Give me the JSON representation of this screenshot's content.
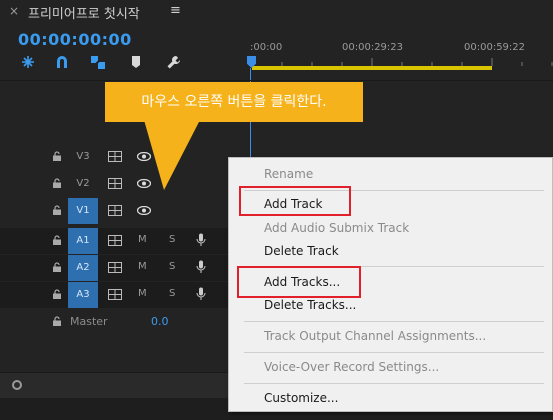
{
  "tab": {
    "close_label": "×",
    "title": "프리미어프로 첫시작",
    "menu_label": "≡"
  },
  "timecode": "00:00:00:00",
  "tools": [
    "ripple-snap-icon",
    "magnet-icon",
    "linked-selection-icon",
    "marker-icon",
    "wrench-icon"
  ],
  "ruler": {
    "labels": [
      ":00:00",
      "00:00:29:23",
      "00:00:59:22"
    ]
  },
  "tracks": [
    {
      "name": "V3",
      "kind": "video",
      "active": false
    },
    {
      "name": "V2",
      "kind": "video",
      "active": false
    },
    {
      "name": "V1",
      "kind": "video",
      "active": true
    },
    {
      "name": "A1",
      "kind": "audio",
      "active": true,
      "m": "M",
      "s": "S"
    },
    {
      "name": "A2",
      "kind": "audio",
      "active": true,
      "m": "M",
      "s": "S"
    },
    {
      "name": "A3",
      "kind": "audio",
      "active": true,
      "m": "M",
      "s": "S"
    }
  ],
  "master": {
    "label": "Master",
    "value": "0.0"
  },
  "callout": {
    "text": "마우스 오른쪽 버튼을 클릭한다."
  },
  "menu": {
    "items": [
      {
        "label": "Rename",
        "disabled": true
      },
      {
        "label": "Add Track",
        "disabled": false,
        "highlighted": true
      },
      {
        "label": "Add Audio Submix Track",
        "disabled": true
      },
      {
        "label": "Delete Track",
        "disabled": false
      },
      {
        "label": "Add Tracks...",
        "disabled": false,
        "highlighted": true
      },
      {
        "label": "Delete Tracks...",
        "disabled": false
      },
      {
        "label": "Track Output Channel Assignments...",
        "disabled": true
      },
      {
        "label": "Voice-Over Record Settings...",
        "disabled": true
      },
      {
        "label": "Customize...",
        "disabled": false
      }
    ]
  },
  "colors": {
    "accent": "#3a9cf0",
    "track_active": "#2e6fb0",
    "callout": "#f5b21a",
    "highlight": "#e0202a",
    "work_area": "#d9c400"
  }
}
